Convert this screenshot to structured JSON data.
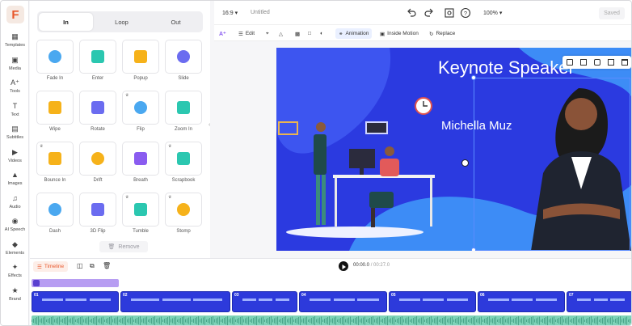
{
  "app": {
    "logo_letter": "F",
    "accent": "#e8562a"
  },
  "leftnav": {
    "items": [
      {
        "label": "Templates",
        "icon": "templates-icon"
      },
      {
        "label": "Media",
        "icon": "media-icon"
      },
      {
        "label": "Tools",
        "icon": "tools-icon"
      },
      {
        "label": "Text",
        "icon": "text-icon"
      },
      {
        "label": "Subtitles",
        "icon": "subtitles-icon"
      },
      {
        "label": "Videos",
        "icon": "videos-icon"
      },
      {
        "label": "Images",
        "icon": "images-icon"
      },
      {
        "label": "Audio",
        "icon": "audio-icon"
      },
      {
        "label": "AI Speech",
        "icon": "ai-speech-icon"
      },
      {
        "label": "Elements",
        "icon": "elements-icon"
      },
      {
        "label": "Effects",
        "icon": "effects-icon"
      },
      {
        "label": "Brand",
        "icon": "brand-icon"
      }
    ]
  },
  "panel": {
    "tabs": [
      "In",
      "Loop",
      "Out"
    ],
    "active_tab": "In",
    "animations": [
      {
        "label": "Fade In",
        "premium": false
      },
      {
        "label": "Enter",
        "premium": false
      },
      {
        "label": "Popup",
        "premium": false
      },
      {
        "label": "Slide",
        "premium": false
      },
      {
        "label": "Wipe",
        "premium": false
      },
      {
        "label": "Rotate",
        "premium": false
      },
      {
        "label": "Flip",
        "premium": true
      },
      {
        "label": "Zoom In",
        "premium": false
      },
      {
        "label": "Bounce In",
        "premium": true
      },
      {
        "label": "Drift",
        "premium": false
      },
      {
        "label": "Breath",
        "premium": false
      },
      {
        "label": "Scrapbook",
        "premium": true
      },
      {
        "label": "Dash",
        "premium": false
      },
      {
        "label": "3D Flip",
        "premium": false
      },
      {
        "label": "Tumble",
        "premium": true
      },
      {
        "label": "Stomp",
        "premium": true
      }
    ],
    "remove_label": "Remove"
  },
  "topbar": {
    "aspect": "16:9",
    "project_name": "Untitled",
    "zoom": "100%",
    "saved_label": "Saved"
  },
  "toolbar": {
    "edit_label": "Edit",
    "animation_label": "Animation",
    "inside_motion_label": "Inside Motion",
    "replace_label": "Replace"
  },
  "canvas": {
    "title": "Keynote Speaker",
    "subtitle": "Michella Muz"
  },
  "timeline": {
    "label": "Timeline",
    "current_time": "00:00.0",
    "separator": "/",
    "total_time": "00:27.0",
    "clips": [
      "01",
      "02",
      "03",
      "04",
      "05",
      "06",
      "07"
    ]
  }
}
